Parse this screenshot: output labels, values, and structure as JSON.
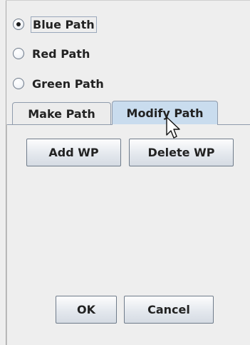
{
  "radio_options": [
    {
      "label": "Blue Path",
      "selected": true
    },
    {
      "label": "Red Path",
      "selected": false
    },
    {
      "label": "Green Path",
      "selected": false
    }
  ],
  "tabs": [
    {
      "label": "Make Path",
      "selected": false
    },
    {
      "label": "Modify Path",
      "selected": true
    }
  ],
  "waypoint_buttons": {
    "add_label": "Add WP",
    "delete_label": "Delete WP"
  },
  "dialog_buttons": {
    "ok_label": "OK",
    "cancel_label": "Cancel"
  },
  "colors": {
    "selected_tab": "#c9dcee",
    "background": "#eeeeee",
    "border": "#8f9bac"
  },
  "icons": {
    "cursor": "pointer-cursor-icon"
  }
}
